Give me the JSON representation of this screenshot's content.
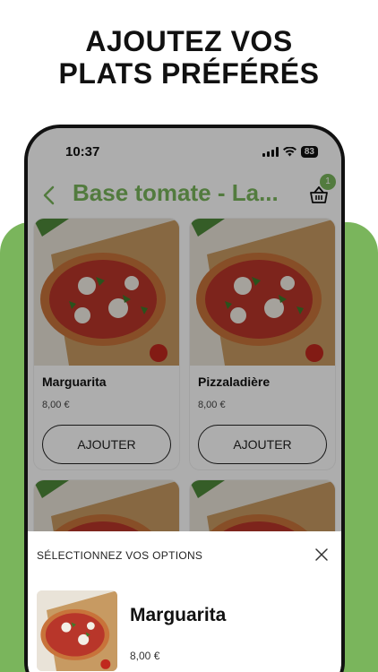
{
  "headline": {
    "line1": "AJOUTEZ VOS",
    "line2": "PLATS PRÉFÉRÉS"
  },
  "colors": {
    "brand_green": "#7ab55c"
  },
  "status_bar": {
    "time": "10:37",
    "battery": "83"
  },
  "header": {
    "title": "Base tomate - La...",
    "cart_count": "1"
  },
  "products": [
    {
      "name": "Marguarita",
      "price": "8,00 €",
      "button": "AJOUTER"
    },
    {
      "name": "Pizzaladière",
      "price": "8,00 €",
      "button": "AJOUTER"
    }
  ],
  "sheet": {
    "title": "SÉLECTIONNEZ VOS OPTIONS",
    "product_name": "Marguarita",
    "price": "8,00 €"
  }
}
